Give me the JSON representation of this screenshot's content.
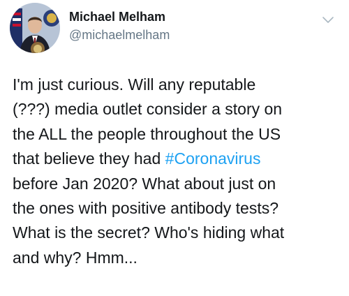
{
  "author": {
    "display_name": "Michael Melham",
    "handle": "@michaelmelham"
  },
  "tweet": {
    "lines": [
      {
        "text": "I'm just curious.  Will any reputable"
      },
      {
        "text": "(???) media outlet consider a story on"
      },
      {
        "text": "the ALL the people throughout the US"
      },
      {
        "before": "that believe they had ",
        "hashtag": "#Coronavirus",
        "after": ""
      },
      {
        "text": "before Jan 2020? What about just on"
      },
      {
        "text": "the ones with positive antibody tests?"
      },
      {
        "text": "What is the secret? Who's hiding what"
      },
      {
        "text": "and why? Hmm..."
      }
    ]
  },
  "icons": {
    "more_menu": "chevron-down-icon",
    "avatar": "profile-photo"
  },
  "colors": {
    "text": "#14171a",
    "secondary_text": "#657786",
    "hashtag": "#1da1f2",
    "caret": "#aab8c2"
  }
}
